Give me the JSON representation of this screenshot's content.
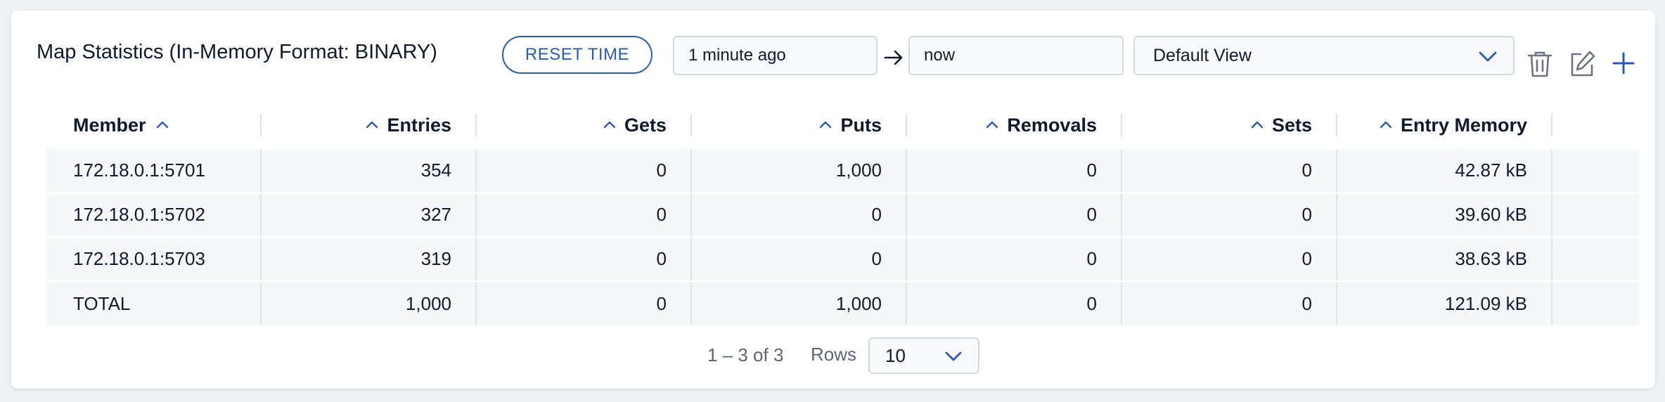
{
  "header": {
    "title": "Map Statistics (In-Memory Format: BINARY)",
    "reset_label": "RESET TIME",
    "time_from": "1 minute ago",
    "time_to": "now",
    "view_selected": "Default View"
  },
  "table": {
    "columns": [
      "Member",
      "Entries",
      "Gets",
      "Puts",
      "Removals",
      "Sets",
      "Entry Memory"
    ],
    "rows": [
      [
        "172.18.0.1:5701",
        "354",
        "0",
        "1,000",
        "0",
        "0",
        "42.87 kB"
      ],
      [
        "172.18.0.1:5702",
        "327",
        "0",
        "0",
        "0",
        "0",
        "39.60 kB"
      ],
      [
        "172.18.0.1:5703",
        "319",
        "0",
        "0",
        "0",
        "0",
        "38.63 kB"
      ],
      [
        "TOTAL",
        "1,000",
        "0",
        "1,000",
        "0",
        "0",
        "121.09 kB"
      ]
    ]
  },
  "pagination": {
    "range": "1 – 3 of 3",
    "rows_label": "Rows",
    "rows_value": "10"
  },
  "icons": {
    "arrow": "arrow-right-icon",
    "trash": "trash-icon",
    "edit": "edit-icon",
    "add": "plus-icon",
    "sort": "sort-ascending-icon",
    "dropdown": "chevron-down-icon"
  },
  "colors": {
    "accent": "#2a5bb3",
    "text": "#0f1a2e",
    "row_background": "#f6f7f8",
    "border": "#d4d8df"
  }
}
